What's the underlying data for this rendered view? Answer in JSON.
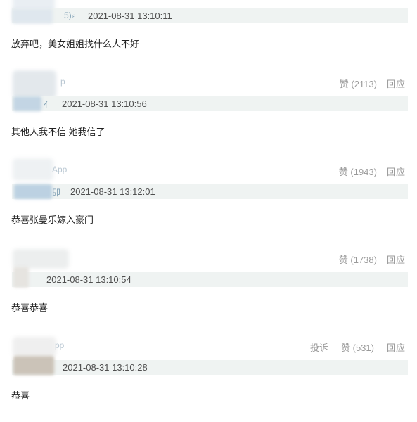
{
  "comments": [
    {
      "source_tail": "",
      "meta_glyph": "5)⸗",
      "time": "2021-08-31 13:10:11",
      "text": "放弃吧，美女姐姐找什么人不好",
      "like_label": "",
      "reply_label": "",
      "report_label": ""
    },
    {
      "source_tail": "p",
      "meta_glyph": "⺅",
      "time": "2021-08-31 13:10:56",
      "text": "其他人我不信 她我信了",
      "like_label": "赞 (2113)",
      "reply_label": "回应",
      "report_label": ""
    },
    {
      "source_tail": "App",
      "meta_glyph": "即",
      "time": "2021-08-31 13:12:01",
      "text": "恭喜张曼乐嫁入豪门",
      "like_label": "赞 (1943)",
      "reply_label": "回应",
      "report_label": ""
    },
    {
      "source_tail": "",
      "meta_glyph": "",
      "time": "2021-08-31 13:10:54",
      "text": "恭喜恭喜",
      "like_label": "赞 (1738)",
      "reply_label": "回应",
      "report_label": ""
    },
    {
      "source_tail": "pp",
      "meta_glyph": "",
      "time": "2021-08-31 13:10:28",
      "text": "恭喜",
      "like_label": "赞 (531)",
      "reply_label": "回应",
      "report_label": "投诉"
    }
  ]
}
